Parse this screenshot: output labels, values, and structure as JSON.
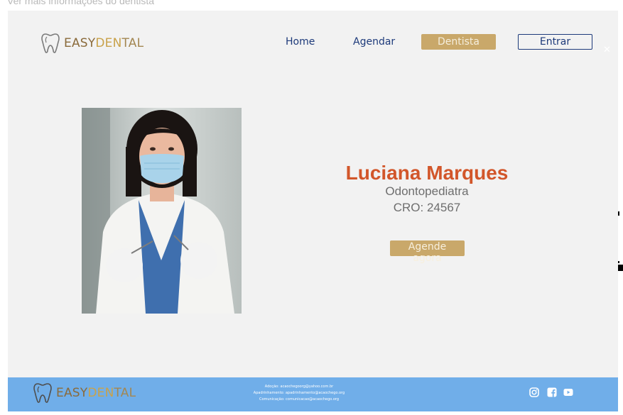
{
  "page": {
    "caption": "Ver mais informações do dentista"
  },
  "brand": {
    "part_a": "EASY",
    "part_b": "DEN",
    "part_c": "TAL"
  },
  "nav": {
    "home": "Home",
    "agendar": "Agendar",
    "dentista": "Dentista",
    "entrar": "Entrar",
    "close": "✕"
  },
  "dentist": {
    "name": "Luciana Marques",
    "specialty": "Odontopediatra",
    "cro": "CRO: 24567",
    "cta": "Agende agora"
  },
  "footer": {
    "contacts": [
      "Adoção: acaochegoorg@yahoo.com.br",
      "Apadrinhamento: apadrinhamento@acaochego.org",
      "Comunicação: comunicacao@acaochego.org"
    ],
    "social": [
      "instagram-icon",
      "facebook-icon",
      "youtube-icon"
    ]
  },
  "colors": {
    "accent_gold": "#c9a86a",
    "navy": "#1d3a7a",
    "name_orange": "#d2562a",
    "footer_blue": "#70aee9"
  }
}
